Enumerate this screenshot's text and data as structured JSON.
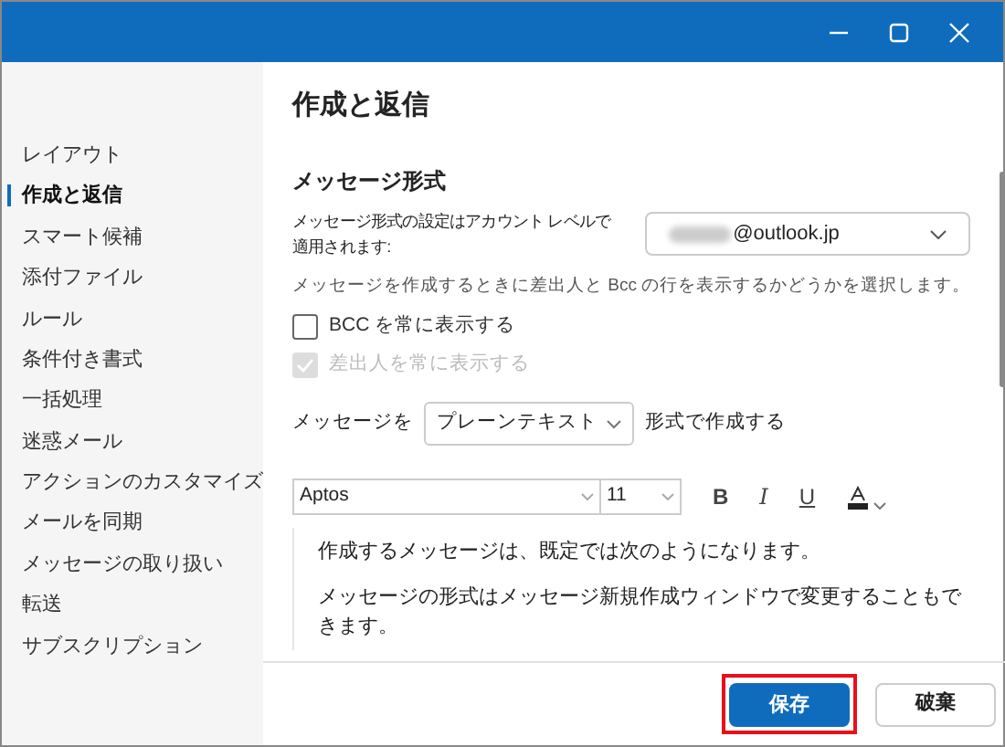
{
  "sidebar": {
    "items": [
      {
        "label": "レイアウト",
        "selected": false
      },
      {
        "label": "作成と返信",
        "selected": true
      },
      {
        "label": "スマート候補",
        "selected": false
      },
      {
        "label": "添付ファイル",
        "selected": false
      },
      {
        "label": "ルール",
        "selected": false
      },
      {
        "label": "条件付き書式",
        "selected": false
      },
      {
        "label": "一括処理",
        "selected": false
      },
      {
        "label": "迷惑メール",
        "selected": false
      },
      {
        "label": "アクションのカスタマイズ",
        "selected": false
      },
      {
        "label": "メールを同期",
        "selected": false
      },
      {
        "label": "メッセージの取り扱い",
        "selected": false
      },
      {
        "label": "転送",
        "selected": false
      },
      {
        "label": "サブスクリプション",
        "selected": false
      }
    ]
  },
  "page_title": "作成と返信",
  "section_title": "メッセージ形式",
  "account_label": [
    "メッセージ形式の設定はアカウント レベルで",
    "適用されます:"
  ],
  "account_dropdown": {
    "value": "@outlook.jp",
    "masked_prefix": true
  },
  "description": "メッセージを作成するときに差出人と Bcc の行を表示するかどうかを選択します。",
  "checkboxes": [
    {
      "label": "BCC を常に表示する",
      "checked": false,
      "disabled": false
    },
    {
      "label": "差出人を常に表示する",
      "checked": true,
      "disabled": true
    }
  ],
  "compose_format": {
    "prefix": "メッセージを",
    "value": "プレーンテキスト",
    "suffix": "形式で作成する"
  },
  "toolbar": {
    "font": "Aptos",
    "size": "11",
    "buttons": [
      "B",
      "I",
      "U"
    ]
  },
  "preview": [
    "作成するメッセージは、既定では次のようになります。",
    "メッセージの形式はメッセージ新規作成ウィンドウで変更することもできます。"
  ],
  "footer": {
    "buttons": [
      {
        "label": "保存",
        "kind": "primary",
        "highlighted": true
      },
      {
        "label": "破棄",
        "kind": "secondary",
        "highlighted": false
      }
    ]
  }
}
